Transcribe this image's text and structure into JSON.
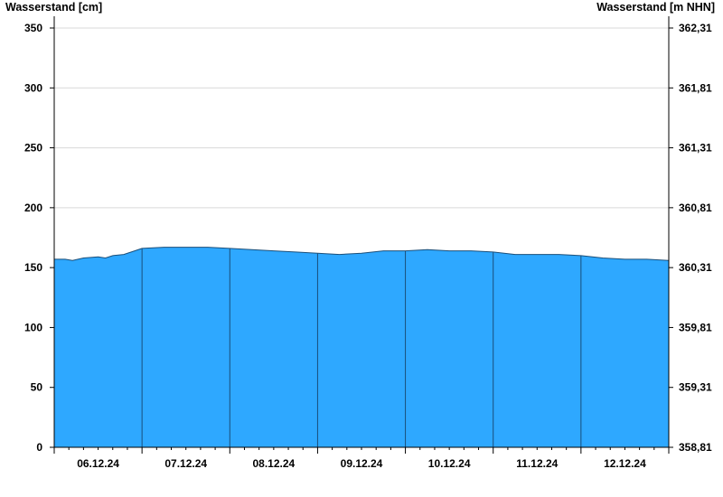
{
  "chart_data": {
    "type": "area",
    "title": "",
    "ylabel_left": "Wasserstand [cm]",
    "ylabel_right": "Wasserstand [m NHN]",
    "ylim": [
      0,
      355
    ],
    "yticks_left": [
      0,
      50,
      100,
      150,
      200,
      250,
      300,
      350
    ],
    "yticks_right": [
      "358,81",
      "359,31",
      "359,81",
      "360,31",
      "360,81",
      "361,31",
      "361,81",
      "362,31"
    ],
    "xlim": [
      "06.12.24 00:00",
      "13.12.24 00:00"
    ],
    "day_labels": [
      "06.12.24",
      "07.12.24",
      "08.12.24",
      "09.12.24",
      "10.12.24",
      "11.12.24",
      "12.12.24"
    ],
    "grid": true,
    "fill_color": "#2ea8ff",
    "series": [
      {
        "x": [
          "06.12.24 00:00",
          "06.12.24 03:00",
          "06.12.24 05:00",
          "06.12.24 08:00",
          "06.12.24 12:00",
          "06.12.24 14:00",
          "06.12.24 16:00",
          "06.12.24 19:00",
          "06.12.24 22:00",
          "07.12.24 00:00",
          "07.12.24 06:00",
          "07.12.24 12:00",
          "07.12.24 18:00",
          "08.12.24 00:00",
          "08.12.24 06:00",
          "08.12.24 12:00",
          "08.12.24 18:00",
          "09.12.24 00:00",
          "09.12.24 06:00",
          "09.12.24 12:00",
          "09.12.24 18:00",
          "10.12.24 00:00",
          "10.12.24 06:00",
          "10.12.24 12:00",
          "10.12.24 18:00",
          "11.12.24 00:00",
          "11.12.24 06:00",
          "11.12.24 12:00",
          "11.12.24 18:00",
          "12.12.24 00:00",
          "12.12.24 06:00",
          "12.12.24 12:00",
          "12.12.24 18:00",
          "13.12.24 00:00"
        ],
        "values": [
          157,
          157,
          156,
          158,
          159,
          158,
          160,
          161,
          164,
          166,
          167,
          167,
          167,
          166,
          165,
          164,
          163,
          162,
          161,
          162,
          164,
          164,
          165,
          164,
          164,
          163,
          161,
          161,
          161,
          160,
          158,
          157,
          157,
          156
        ]
      }
    ]
  }
}
